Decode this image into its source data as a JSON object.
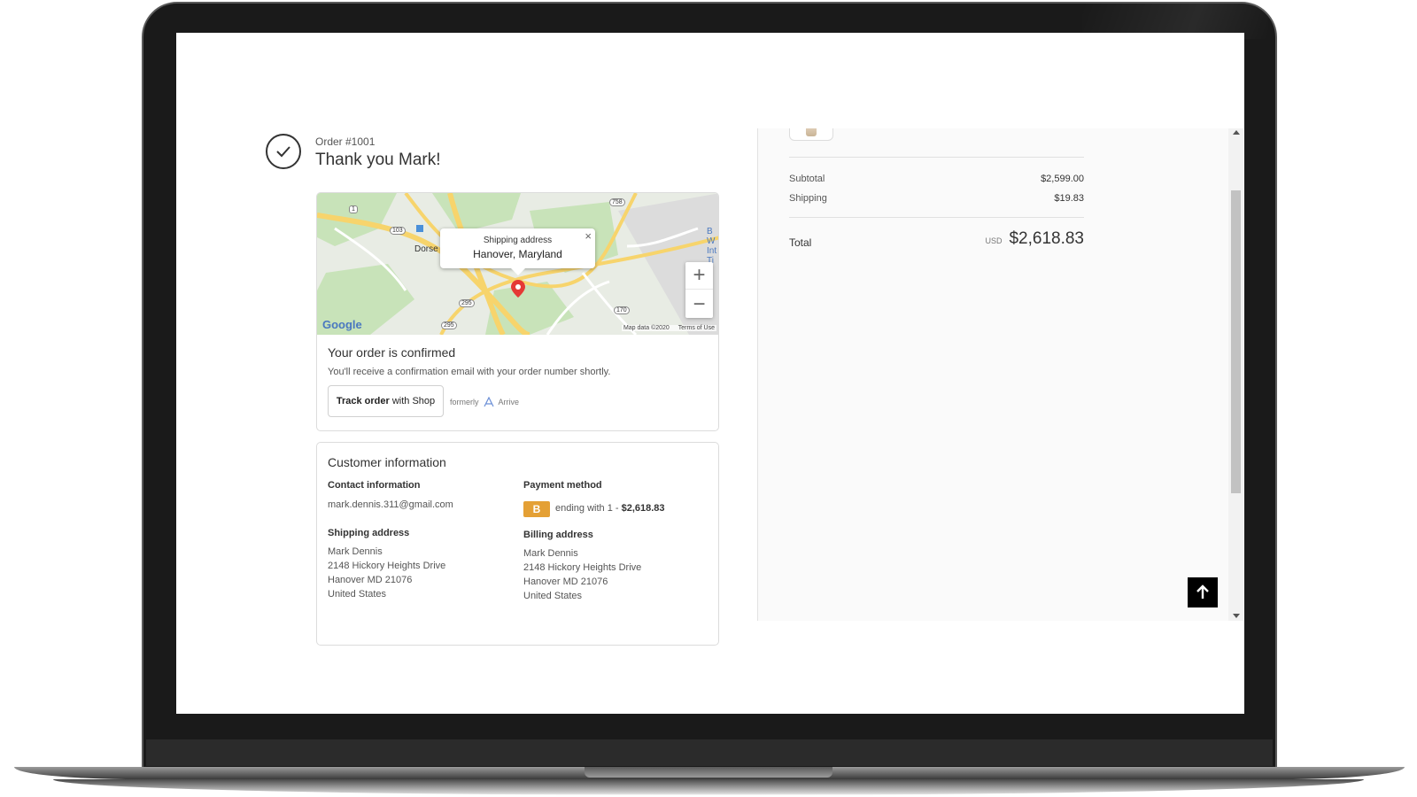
{
  "order": {
    "number": "Order #1001",
    "thank_you": "Thank you Mark!"
  },
  "map": {
    "popup_label": "Shipping address",
    "popup_city": "Hanover, Maryland",
    "popup_close": "×",
    "zoom_in": "+",
    "zoom_out": "−",
    "logo": "Google",
    "attribution": "Map data ©2020",
    "terms": "Terms of Use",
    "road_labels": [
      "1",
      "103",
      "295",
      "295",
      "170",
      "758"
    ],
    "place_labels": [
      "Dorse"
    ],
    "partial_label_right": "B W Int Ti",
    "pin_color": "#e53935",
    "road_color": "#f7d46c"
  },
  "confirmation": {
    "title": "Your order is confirmed",
    "message": "You'll receive a confirmation email with your order number shortly.",
    "track_bold": "Track order",
    "track_rest": "with Shop",
    "formerly": "formerly",
    "arrive": "Arrive"
  },
  "customer": {
    "title": "Customer information",
    "contact_label": "Contact information",
    "email": "mark.dennis.311@gmail.com",
    "payment_label": "Payment method",
    "payment_badge": "B",
    "payment_text": "ending with 1 -",
    "payment_amount": "$2,618.83",
    "shipping_label": "Shipping address",
    "shipping_lines": [
      "Mark Dennis",
      "2148 Hickory Heights Drive",
      "Hanover MD 21076",
      "United States"
    ],
    "billing_label": "Billing address",
    "billing_lines": [
      "Mark Dennis",
      "2148 Hickory Heights Drive",
      "Hanover MD 21076",
      "United States"
    ]
  },
  "summary": {
    "subtotal_label": "Subtotal",
    "subtotal": "$2,599.00",
    "shipping_label": "Shipping",
    "shipping": "$19.83",
    "total_label": "Total",
    "currency": "USD",
    "total": "$2,618.83"
  },
  "icons": {
    "check": "check-circle-icon",
    "back_to_top": "arrow-up-icon",
    "map_pin": "map-pin-icon"
  }
}
